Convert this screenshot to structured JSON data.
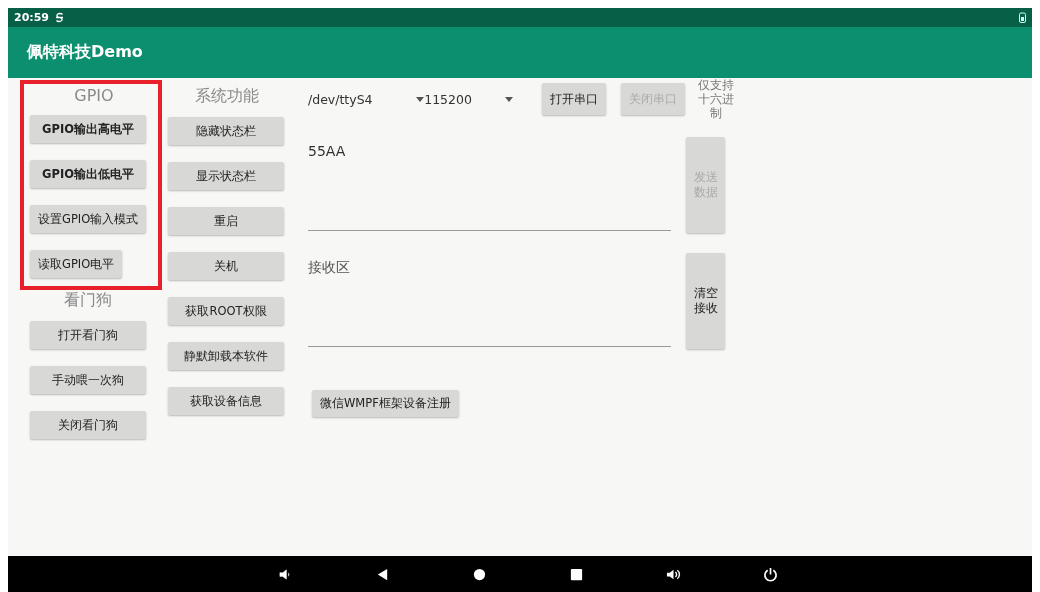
{
  "status_bar": {
    "time": "20:59"
  },
  "app_bar": {
    "title": "佩特科技Demo"
  },
  "gpio": {
    "title": "GPIO",
    "highlighted": true,
    "buttons": [
      {
        "label": "GPIO输出高电平",
        "bold": true
      },
      {
        "label": "GPIO输出低电平",
        "bold": true
      },
      {
        "label": "设置GPIO输入模式",
        "bold": false
      },
      {
        "label": "读取GPIO电平",
        "bold": false
      }
    ]
  },
  "watchdog": {
    "title": "看门狗",
    "buttons": [
      {
        "label": "打开看门狗"
      },
      {
        "label": "手动喂一次狗"
      },
      {
        "label": "关闭看门狗"
      }
    ]
  },
  "system": {
    "title": "系统功能",
    "buttons": [
      {
        "label": "隐藏状态栏"
      },
      {
        "label": "显示状态栏"
      },
      {
        "label": "重启"
      },
      {
        "label": "关机"
      },
      {
        "label": "获取ROOT权限"
      },
      {
        "label": "静默卸载本软件"
      },
      {
        "label": "获取设备信息"
      }
    ]
  },
  "serial": {
    "port": "/dev/ttyS4",
    "baud": "115200",
    "buttons": [
      {
        "label": "打开串口",
        "disabled": false
      },
      {
        "label": "关闭串口",
        "disabled": true
      }
    ],
    "hint": "仅支持十六进制",
    "send_field": {
      "value": "55AA"
    },
    "send_button": {
      "label": "发送数据",
      "disabled": true
    },
    "receive_field": {
      "placeholder": "接收区"
    },
    "clear_button": {
      "label": "清空接收",
      "disabled": false
    },
    "wmpf_button": {
      "label": "微信WMPF框架设备注册"
    }
  }
}
